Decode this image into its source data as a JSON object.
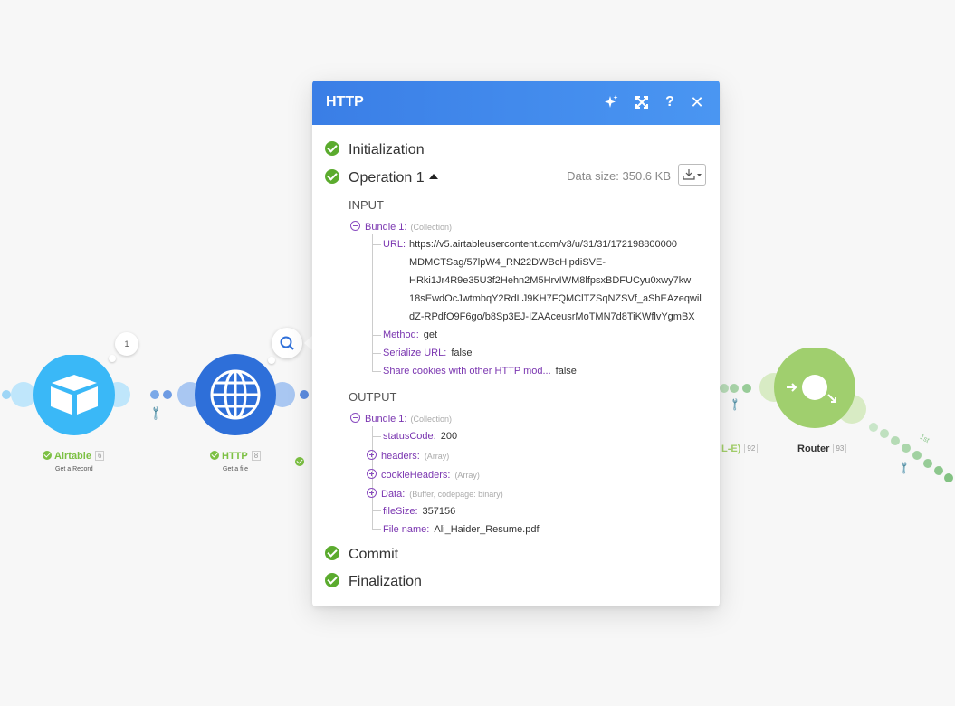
{
  "panel": {
    "title": "HTTP",
    "stages": {
      "initialization": "Initialization",
      "operation": "Operation 1",
      "commit": "Commit",
      "finalization": "Finalization"
    },
    "data_size": "Data size: 350.6 KB",
    "input": {
      "title": "INPUT",
      "bundle_label": "Bundle 1:",
      "bundle_type": "(Collection)",
      "url_key": "URL:",
      "url_lines": [
        "https://v5.airtableusercontent.com/v3/u/31/31/172198800000",
        "MDMCTSag/57lpW4_RN22DWBcHlpdiSVE-",
        "HRki1Jr4R9e35U3f2Hehn2M5HrvIWM8lfpsxBDFUCyu0xwy7kw",
        "18sEwdOcJwtmbqY2RdLJ9KH7FQMClTZSqNZSVf_aShEAzeqwil",
        "dZ-RPdfO9F6go/b8Sp3EJ-IZAAceusrMoTMN7d8TiKWflvYgmBX"
      ],
      "method_key": "Method:",
      "method_val": "get",
      "serialize_key": "Serialize URL:",
      "serialize_val": "false",
      "share_key": "Share cookies with other HTTP mod...",
      "share_val": "false"
    },
    "output": {
      "title": "OUTPUT",
      "bundle_label": "Bundle 1:",
      "bundle_type": "(Collection)",
      "status_key": "statusCode:",
      "status_val": "200",
      "headers_key": "headers:",
      "headers_type": "(Array)",
      "cookie_key": "cookieHeaders:",
      "cookie_type": "(Array)",
      "data_key": "Data:",
      "data_type": "(Buffer, codepage: binary)",
      "filesize_key": "fileSize:",
      "filesize_val": "357156",
      "filename_key": "File name:",
      "filename_val": "Ali_Haider_Resume.pdf"
    }
  },
  "canvas": {
    "airtable": {
      "label": "Airtable",
      "id": "6",
      "sub": "Get a Record",
      "badge": "1"
    },
    "http": {
      "label": "HTTP",
      "id": "8",
      "sub": "Get a file"
    },
    "hidden_module": {
      "label": "L-E)",
      "id": "92"
    },
    "router": {
      "label": "Router",
      "id": "93"
    },
    "route_label": "1st"
  },
  "colors": {
    "header_gradient_start": "#3a7ee6",
    "header_gradient_end": "#4a96f2",
    "success_green": "#5bab2e",
    "airtable_blue": "#3ab8f7",
    "http_blue": "#2e6fd9",
    "router_green": "#a0cf6e",
    "key_purple": "#7a35b0"
  }
}
